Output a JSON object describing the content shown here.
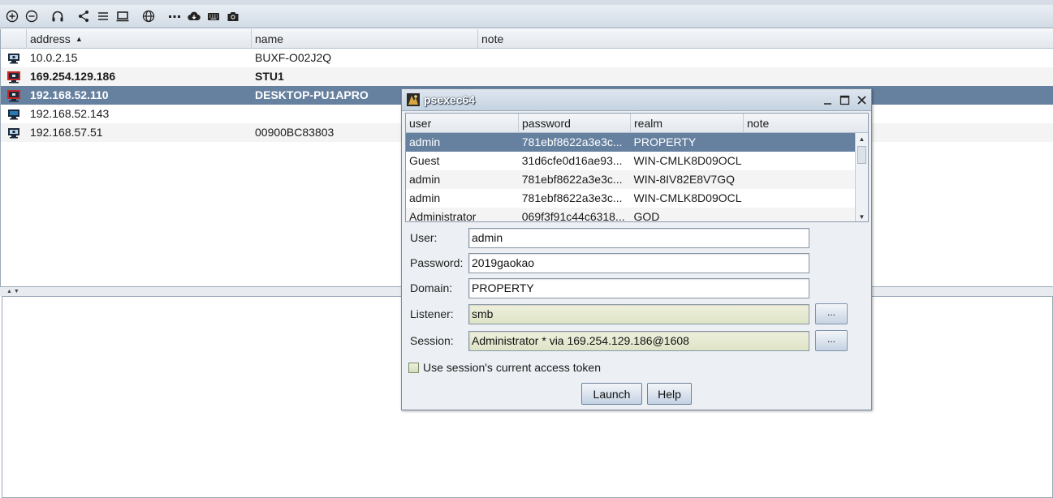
{
  "toolbar": {
    "icons": [
      "add-connection-icon",
      "remove-connection-icon",
      "headphones-listeners-icon",
      "share-graph-icon",
      "list-view-icon",
      "table-view-icon",
      "globe-icon",
      "dots-icon",
      "cloud-download-icon",
      "keyboard-icon",
      "camera-screenshot-icon"
    ]
  },
  "targets": {
    "columns": {
      "address": "address",
      "name": "name",
      "note": "note"
    },
    "rows": [
      {
        "address": "10.0.2.15",
        "name": "BUXF-O02J2Q",
        "note": ""
      },
      {
        "address": "169.254.129.186",
        "name": "STU1",
        "note": ""
      },
      {
        "address": "192.168.52.110",
        "name": "DESKTOP-PU1APRO",
        "note": ""
      },
      {
        "address": "192.168.52.143",
        "name": "",
        "note": ""
      },
      {
        "address": "192.168.57.51",
        "name": "00900BC83803",
        "note": ""
      }
    ]
  },
  "dialog": {
    "title": "psexec64",
    "cred_columns": {
      "user": "user",
      "password": "password",
      "realm": "realm",
      "note": "note"
    },
    "credentials": [
      {
        "user": "admin",
        "password": "781ebf8622a3e3c...",
        "realm": "PROPERTY",
        "note": ""
      },
      {
        "user": "Guest",
        "password": "31d6cfe0d16ae93...",
        "realm": "WIN-CMLK8D09OCL",
        "note": ""
      },
      {
        "user": "admin",
        "password": "781ebf8622a3e3c...",
        "realm": "WIN-8IV82E8V7GQ",
        "note": ""
      },
      {
        "user": "admin",
        "password": "781ebf8622a3e3c...",
        "realm": "WIN-CMLK8D09OCL",
        "note": ""
      },
      {
        "user": "Administrator",
        "password": "069f3f91c44c6318...",
        "realm": "GOD",
        "note": ""
      }
    ],
    "form": {
      "user_label": "User:",
      "user_value": "admin",
      "password_label": "Password:",
      "password_value": "2019gaokao",
      "domain_label": "Domain:",
      "domain_value": "PROPERTY",
      "listener_label": "Listener:",
      "listener_value": "smb",
      "session_label": "Session:",
      "session_value": "Administrator * via  169.254.129.186@1608",
      "browse_label": "...",
      "checkbox_label": "Use session's current access token"
    },
    "buttons": {
      "launch": "Launch",
      "help": "Help"
    }
  },
  "splitter": {
    "arrows": "▲ ▼"
  },
  "colors": {
    "selection": "#6680a0",
    "readonly_field": "#e6e9cf",
    "beacon_red": "#c62828"
  }
}
